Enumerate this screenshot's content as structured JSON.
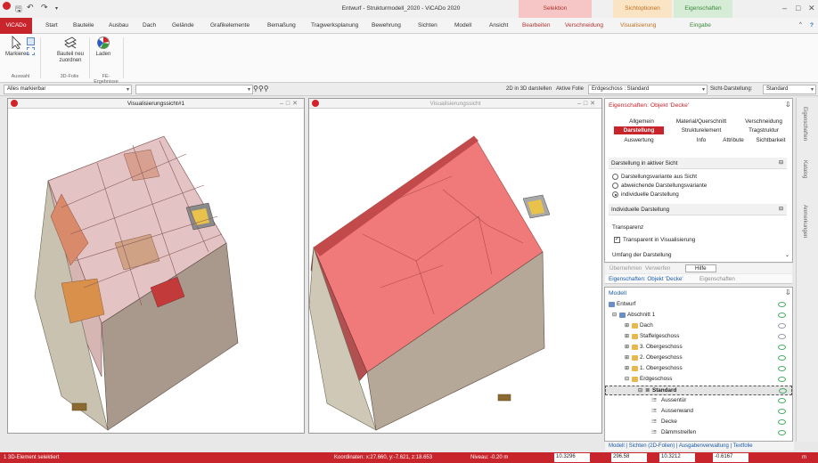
{
  "window": {
    "title": "Entwurf - Strukturmodell_2020 - ViCADo 2020",
    "controls": [
      "–",
      "□",
      "✕"
    ]
  },
  "context_groups": {
    "selektion": "Selektion",
    "sichtoptionen": "Sichtoptionen",
    "eigenschaften": "Eigenschaften"
  },
  "tabs": [
    "ViCADo",
    "Start",
    "Bauteile",
    "Ausbau",
    "Dach",
    "Gelände",
    "Grafikelemente",
    "Bemaßung",
    "Tragwerksplanung",
    "Bewehrung",
    "Sichten",
    "Modell",
    "Ansicht",
    "Bearbeiten",
    "Verschneidung",
    "Visualisierung",
    "Eingabe"
  ],
  "ribbon": {
    "buttons": {
      "markieren": "Markieren",
      "bauteil": "Bauteil neu zuordnen",
      "laden": "Laden"
    },
    "groups": {
      "auswahl": "Auswahl",
      "folie3d": "3D-Folie",
      "fe": "FE-Ergebnisse"
    }
  },
  "toolbar2": {
    "filter": "Alles markierbar",
    "mode2d3d": "2D in 3D darstellen",
    "aktive_folie": "Aktive Folie",
    "geschoss": "Erdgeschoss : Standard",
    "sicht_label": "Sicht-Darstellung:",
    "sicht_value": "Standard"
  },
  "views": {
    "left": "Visualisierungssicht#1",
    "right": "Visualisierungssicht"
  },
  "props": {
    "title": "Eigenschaften: Objekt 'Decke'",
    "tabs": [
      "Allgemein",
      "Material/Querschnitt",
      "Verschneidung",
      "Darstellung",
      "Strukturelement",
      "Tragstruktur",
      "Auswertung",
      "Info",
      "Attribute",
      "Sichtbarkeit"
    ],
    "sec1": "Darstellung in aktiver Sicht",
    "radios": [
      "Darstellungsvariante aus Sicht",
      "abweichende Darstellungsvariante",
      "individuelle Darstellung"
    ],
    "sec2": "Individuelle Darstellung",
    "transparenz": "Transparenz",
    "chk": "Transparent in Visualisierung",
    "umfang": "Umfang der Darstellung",
    "btns": [
      "Übernehmen",
      "Verwerfen",
      "Hilfe"
    ],
    "ptabs": [
      "Eigenschaften: Objekt 'Decke'",
      "Eigenschaften"
    ]
  },
  "model": {
    "title": "Modell",
    "items": [
      "Entwurf",
      "Abschnitt 1",
      "Dach",
      "Staffelgeschoss",
      "3. Obergeschoss",
      "2. Obergeschoss",
      "1. Obergeschoss",
      "Erdgeschoss",
      "Standard",
      "Aussentür",
      "Aussenwand",
      "Decke",
      "Dämmstreifen"
    ],
    "bottom_tabs": "Modell | Sichten (2D-Folien) | Ausgabenverwaltung | Textfolie"
  },
  "sidebar": [
    "Eigenschaften",
    "Katalog",
    "Anmerkungen"
  ],
  "status": {
    "left": "1 3D-Element selektiert",
    "coords": "Koordinaten: x:27.660, y:-7.621, z:18.653",
    "niveau": "Niveau: -0.20 m",
    "f1": "10.3296",
    "f2": "296.58",
    "f3": "10.3212",
    "f4": "-0.6167",
    "unit": "m"
  }
}
